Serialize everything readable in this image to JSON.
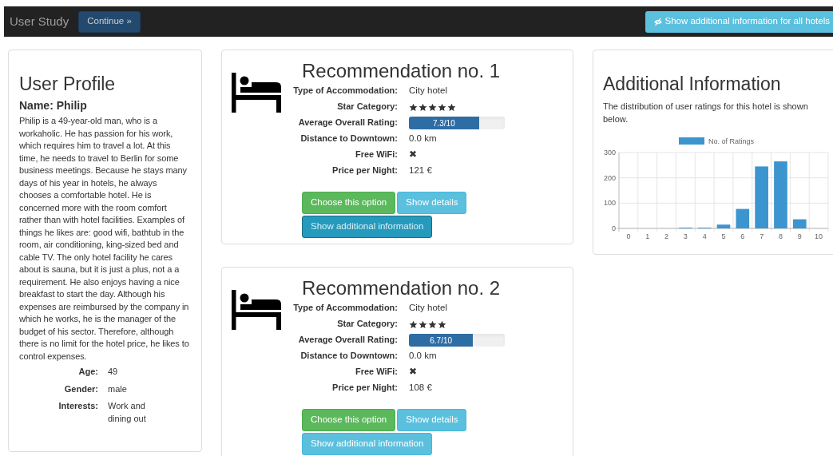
{
  "navbar": {
    "brand": "User Study",
    "continue_button": "Continue »",
    "all_info_button": "Show additional information for all hotels"
  },
  "profile": {
    "title": "User Profile",
    "name": "Name: Philip",
    "description": "Philip is a 49-year-old man, who is a workaholic. He has passion for his work, which requires him to travel a lot. At this time, he needs to travel to Berlin for some business meetings. Because he stays many days of his year in hotels, he always chooses a comfortable hotel. He is concerned more with the room comfort rather than with hotel facilities. Examples of things he likes are: good wifi, bathtub in the room, air conditioning, king-sized bed and cable TV. The only hotel facility he cares about is sauna, but it is just a plus, not a a requirement. He also enjoys having a nice breakfast to start the day. Although his expenses are reimbursed by the company in which he works, he is the manager of the budget of his sector. Therefore, although there is no limit for the hotel price, he likes to control expenses.",
    "facts": [
      {
        "label": "Age:",
        "value": "49"
      },
      {
        "label": "Gender:",
        "value": "male"
      },
      {
        "label": "Interests:",
        "value": "Work and dining out"
      }
    ]
  },
  "recommendations": [
    {
      "title": "Recommendation no. 1",
      "rows": [
        {
          "kind": "text",
          "label": "Type of Accommodation:",
          "value": "City hotel"
        },
        {
          "kind": "stars",
          "label": "Star Category:",
          "stars": 5
        },
        {
          "kind": "rating",
          "label": "Average Overall Rating:",
          "level": 0.73,
          "reading": "7.3/10"
        },
        {
          "kind": "text",
          "label": "Distance to Downtown:",
          "value": "0.0 km"
        },
        {
          "kind": "text",
          "label": "Free WiFi:",
          "value": "✖"
        },
        {
          "kind": "text",
          "label": "Price per Night:",
          "value": "121 €"
        }
      ],
      "choose_button": "Choose this option",
      "details_button": "Show details",
      "info_button": {
        "label": "Show additional information",
        "selected": true
      }
    },
    {
      "title": "Recommendation no. 2",
      "rows": [
        {
          "kind": "text",
          "label": "Type of Accommodation:",
          "value": "City hotel"
        },
        {
          "kind": "stars",
          "label": "Star Category:",
          "stars": 4
        },
        {
          "kind": "rating",
          "label": "Average Overall Rating:",
          "level": 0.67,
          "reading": "6.7/10"
        },
        {
          "kind": "text",
          "label": "Distance to Downtown:",
          "value": "0.0 km"
        },
        {
          "kind": "text",
          "label": "Free WiFi:",
          "value": "✖"
        },
        {
          "kind": "text",
          "label": "Price per Night:",
          "value": "108 €"
        }
      ],
      "choose_button": "Choose this option",
      "details_button": "Show details",
      "info_button": {
        "label": "Show additional information",
        "selected": false
      }
    }
  ],
  "additional_info": {
    "title": "Additional Information",
    "text": "The distribution of user ratings for this hotel is shown below.",
    "chart_data": {
      "type": "bar",
      "categories": [
        "0",
        "1",
        "2",
        "3",
        "4",
        "5",
        "6",
        "7",
        "8",
        "9",
        "10"
      ],
      "series": [
        {
          "name": "No. of Ratings",
          "color": "#3d95cf",
          "values": [
            0,
            0,
            0,
            3,
            3,
            15,
            77,
            245,
            265,
            36,
            0
          ]
        }
      ],
      "ylim": [
        0,
        300
      ],
      "yticks": [
        0,
        100,
        200,
        300
      ]
    }
  }
}
